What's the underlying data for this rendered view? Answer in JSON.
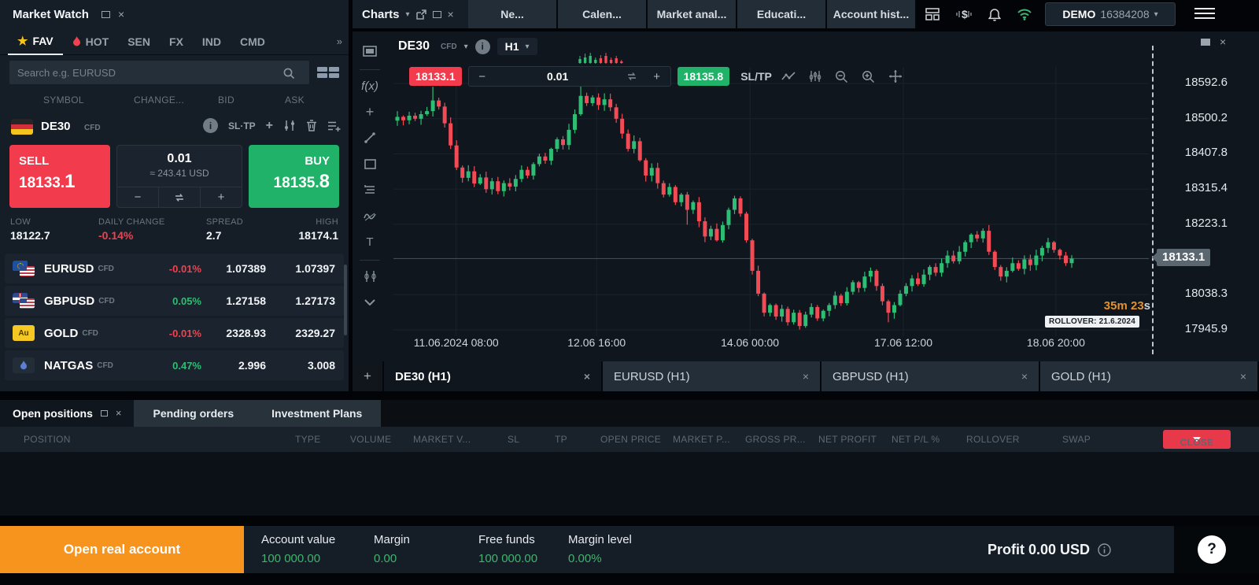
{
  "topbar": {
    "mw_title": "Market Watch",
    "charts_title": "Charts",
    "nav_tabs": [
      "Ne...",
      "Calen...",
      "Market anal...",
      "Educati...",
      "Account hist..."
    ],
    "account": {
      "type": "DEMO",
      "number": "16384208"
    }
  },
  "market_watch": {
    "tabs": [
      {
        "label": "FAV",
        "icon": "star",
        "active": true
      },
      {
        "label": "HOT",
        "icon": "flame"
      },
      {
        "label": "SEN"
      },
      {
        "label": "FX"
      },
      {
        "label": "IND"
      },
      {
        "label": "CMD"
      }
    ],
    "more_label": "»",
    "search_placeholder": "Search e.g. EURUSD",
    "columns": [
      {
        "label": "SYMBOL",
        "x": 55
      },
      {
        "label": "CHANGE...",
        "x": 170
      },
      {
        "label": "BID",
        "x": 277
      },
      {
        "label": "ASK",
        "x": 362
      }
    ],
    "instrument": {
      "symbol": "DE30",
      "type": "CFD",
      "sl_tp": "SL·TP",
      "sell_label": "SELL",
      "sell_price": "18133.1",
      "buy_label": "BUY",
      "buy_price": "18135.8",
      "volume": "0.01",
      "volume_usd": "≈ 243.41 USD",
      "stats": [
        {
          "label": "LOW",
          "value": "18122.7"
        },
        {
          "label": "DAILY CHANGE",
          "value": "-0.14%",
          "color": "red"
        },
        {
          "label": "SPREAD",
          "value": "2.7"
        },
        {
          "label": "HIGH",
          "value": "18174.1"
        }
      ]
    },
    "rows": [
      {
        "symbol": "EURUSD",
        "type": "CFD",
        "change": "-0.01%",
        "dir": "dn",
        "bid": "1.07389",
        "ask": "1.07397",
        "flag": "eurusd"
      },
      {
        "symbol": "GBPUSD",
        "type": "CFD",
        "change": "0.05%",
        "dir": "up",
        "bid": "1.27158",
        "ask": "1.27173",
        "flag": "gbpusd"
      },
      {
        "symbol": "GOLD",
        "type": "CFD",
        "change": "-0.01%",
        "dir": "dn",
        "bid": "2328.93",
        "ask": "2329.27",
        "flag": "gold"
      },
      {
        "symbol": "NATGAS",
        "type": "CFD",
        "change": "0.47%",
        "dir": "up",
        "bid": "2.996",
        "ask": "3.008",
        "flag": "natgas"
      }
    ]
  },
  "chart": {
    "symbol": "DE30",
    "type": "CFD",
    "timeframe": "H1",
    "bid_badge": "18133.1",
    "ask_badge": "18135.8",
    "volume": "0.01",
    "sltp_label": "SL/TP",
    "countdown_value": "35m 23",
    "countdown_unit": "s",
    "rollover": "ROLLOVER: 21.6.2024",
    "current_price": "18133.1",
    "preview_candles": [
      {
        "dir": "up",
        "body": 5,
        "wick": 9
      },
      {
        "dir": "up",
        "body": 7,
        "wick": 12
      },
      {
        "dir": "up",
        "body": 9,
        "wick": 13
      },
      {
        "dir": "up",
        "body": 4,
        "wick": 7
      },
      {
        "dir": "down",
        "body": 6,
        "wick": 10
      },
      {
        "dir": "down",
        "body": 9,
        "wick": 13
      },
      {
        "dir": "down",
        "body": 4,
        "wick": 7
      },
      {
        "dir": "down",
        "body": 6,
        "wick": 9
      },
      {
        "dir": "down",
        "body": 2,
        "wick": 4
      }
    ],
    "tabs": [
      {
        "label": "DE30 (H1)",
        "active": true
      },
      {
        "label": "EURUSD (H1)",
        "active": false
      },
      {
        "label": "GBPUSD (H1)",
        "active": false
      },
      {
        "label": "GOLD (H1)",
        "active": false
      }
    ],
    "add_tab_label": "+"
  },
  "chart_data": {
    "type": "candlestick",
    "symbol": "DE30",
    "timeframe": "H1",
    "y_ticks": [
      18592.6,
      18500.2,
      18407.8,
      18315.4,
      18223.1,
      18038.3,
      17945.9
    ],
    "current_price": 18133.1,
    "x_ticks": [
      "11.06.2024 08:00",
      "12.06 16:00",
      "14.06 00:00",
      "17.06 12:00",
      "18.06 20:00"
    ],
    "x_tick_fractions": [
      0.083,
      0.269,
      0.472,
      0.675,
      0.877
    ],
    "price_range": [
      17935,
      18605
    ],
    "open_first": 18495,
    "closes": [
      18505,
      18496,
      18508,
      18500,
      18512,
      18520,
      18548,
      18532,
      18488,
      18430,
      18372,
      18345,
      18362,
      18330,
      18346,
      18315,
      18336,
      18310,
      18331,
      18322,
      18342,
      18366,
      18351,
      18381,
      18401,
      18390,
      18421,
      18446,
      18431,
      18471,
      18512,
      18560,
      18541,
      18556,
      18536,
      18551,
      18530,
      18500,
      18461,
      18421,
      18441,
      18391,
      18351,
      18371,
      18331,
      18301,
      18321,
      18281,
      18301,
      18261,
      18281,
      18231,
      18191,
      18211,
      18181,
      18221,
      18261,
      18291,
      18251,
      18181,
      18101,
      18041,
      17991,
      18011,
      17981,
      18001,
      17966,
      17991,
      17956,
      17986,
      18006,
      17976,
      17996,
      18011,
      18036,
      18016,
      18046,
      18071,
      18056,
      18086,
      18101,
      18061,
      18021,
      17991,
      18011,
      18041,
      18061,
      18081,
      18066,
      18091,
      18111,
      18096,
      18121,
      18141,
      18126,
      18151,
      18176,
      18196,
      18186,
      18206,
      18151,
      18111,
      18086,
      18101,
      18121,
      18106,
      18131,
      18116,
      18141,
      18161,
      18176,
      18156,
      18141,
      18121,
      18133
    ],
    "wick_overrides": {
      "6": {
        "high": 18584
      },
      "31": {
        "high": 18588
      },
      "49": {
        "low": 18222
      },
      "68": {
        "low": 17947
      },
      "83": {
        "low": 17966
      }
    },
    "colors": {
      "up": "#2ebd74",
      "down": "#f14b56",
      "grid": "#1a232c",
      "price_line": "#49535b"
    }
  },
  "positions_panel": {
    "tabs": [
      "Open positions",
      "Pending orders",
      "Investment Plans"
    ],
    "columns": [
      {
        "label": "POSITION",
        "x": 30
      },
      {
        "label": "TYPE",
        "x": 375
      },
      {
        "label": "VOLUME",
        "x": 445
      },
      {
        "label": "MARKET V...",
        "x": 525
      },
      {
        "label": "SL",
        "x": 645
      },
      {
        "label": "TP",
        "x": 705
      },
      {
        "label": "OPEN PRICE",
        "x": 763
      },
      {
        "label": "MARKET P...",
        "x": 855
      },
      {
        "label": "GROSS PR...",
        "x": 947
      },
      {
        "label": "NET PROFIT",
        "x": 1040
      },
      {
        "label": "NET P/L %",
        "x": 1133
      },
      {
        "label": "ROLLOVER",
        "x": 1228
      },
      {
        "label": "SWAP",
        "x": 1350
      }
    ],
    "close_button": "CLOSE"
  },
  "status_bar": {
    "cta": "Open real account",
    "stats": [
      {
        "label": "Account value",
        "value": "100 000.00",
        "x": 332
      },
      {
        "label": "Margin",
        "value": "0.00",
        "x": 475
      },
      {
        "label": "Free funds",
        "value": "100 000.00",
        "x": 608
      },
      {
        "label": "Margin level",
        "value": "0.00%",
        "x": 722
      }
    ],
    "profit": "Profit 0.00 USD",
    "help_label": "?"
  },
  "colors": {
    "accent_red": "#f23c4d",
    "accent_green": "#1fb268",
    "orange": "#f7941d",
    "value_green": "#3db56c",
    "panel": "#151e27",
    "chart_bg": "#0f161d"
  }
}
